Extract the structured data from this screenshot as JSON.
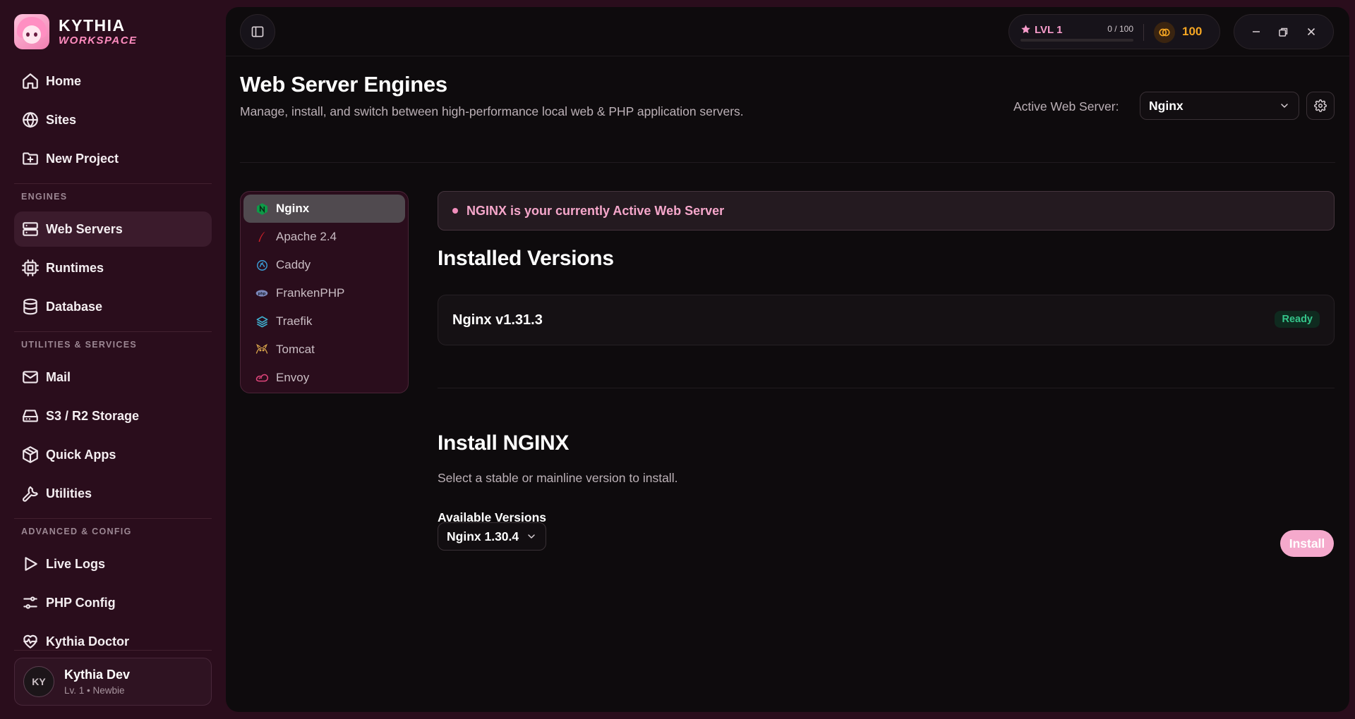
{
  "brand": {
    "title": "KYTHIA",
    "subtitle": "WORKSPACE"
  },
  "sidebar": {
    "items": [
      {
        "label": "Home",
        "icon": "home-icon"
      },
      {
        "label": "Sites",
        "icon": "globe-icon"
      },
      {
        "label": "New Project",
        "icon": "folder-plus-icon"
      }
    ],
    "sections": [
      {
        "title": "ENGINES",
        "items": [
          {
            "label": "Web Servers",
            "icon": "server-icon",
            "active": true
          },
          {
            "label": "Runtimes",
            "icon": "cpu-icon"
          },
          {
            "label": "Database",
            "icon": "database-icon"
          }
        ]
      },
      {
        "title": "UTILITIES & SERVICES",
        "items": [
          {
            "label": "Mail",
            "icon": "mail-icon"
          },
          {
            "label": "S3 / R2 Storage",
            "icon": "hard-drive-icon"
          },
          {
            "label": "Quick Apps",
            "icon": "package-icon"
          },
          {
            "label": "Utilities",
            "icon": "wrench-icon"
          }
        ]
      },
      {
        "title": "ADVANCED & CONFIG",
        "items": [
          {
            "label": "Live Logs",
            "icon": "play-icon"
          },
          {
            "label": "PHP Config",
            "icon": "sliders-icon"
          },
          {
            "label": "Kythia Doctor",
            "icon": "heart-pulse-icon"
          }
        ]
      }
    ]
  },
  "user": {
    "initials": "KY",
    "name": "Kythia Dev",
    "level": "Lv. 1 • Newbie"
  },
  "topbar": {
    "level": "LVL 1",
    "xp": "0 / 100",
    "xp_progress": 0,
    "coins": "100"
  },
  "header": {
    "title": "Web Server Engines",
    "subtitle": "Manage, install, and switch between high-performance local web & PHP application servers.",
    "active_label": "Active Web Server:",
    "active_value": "Nginx"
  },
  "engines": [
    {
      "label": "Nginx",
      "icon": "nginx-icon",
      "active": true
    },
    {
      "label": "Apache 2.4",
      "icon": "apache-feather-icon"
    },
    {
      "label": "Caddy",
      "icon": "caddy-icon"
    },
    {
      "label": "FrankenPHP",
      "icon": "php-icon"
    },
    {
      "label": "Traefik",
      "icon": "traefik-icon"
    },
    {
      "label": "Tomcat",
      "icon": "tomcat-icon"
    },
    {
      "label": "Envoy",
      "icon": "envoy-icon"
    }
  ],
  "notice": "NGINX is your currently Active Web Server",
  "installed": {
    "title": "Installed Versions",
    "items": [
      {
        "name": "Nginx v1.31.3",
        "status": "Ready"
      }
    ]
  },
  "install": {
    "title": "Install NGINX",
    "subtitle": "Select a stable or mainline version to install.",
    "available_label": "Available Versions",
    "selected_version": "Nginx 1.30.4",
    "button_label": "Install"
  },
  "colors": {
    "accent_pink": "#f79ccb",
    "sidebar_bg": "#2a0d1c",
    "main_bg": "#0e0b0d",
    "ready_green": "#35c48a",
    "coin_gold": "#f5a623"
  }
}
